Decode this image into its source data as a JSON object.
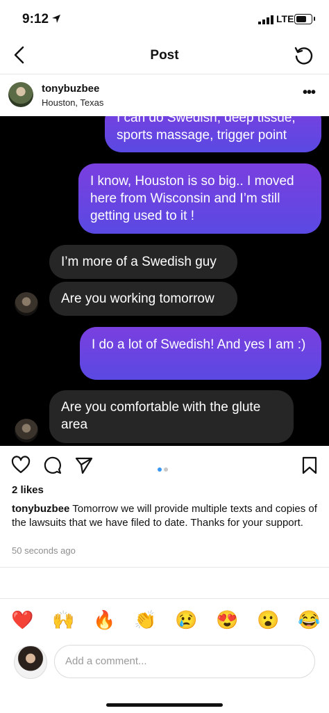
{
  "status": {
    "time": "9:12",
    "network": "LTE"
  },
  "nav": {
    "title": "Post"
  },
  "post": {
    "username": "tonybuzbee",
    "location": "Houston, Texas",
    "more": "•••"
  },
  "chat": {
    "messages": [
      {
        "side": "out",
        "text": "I can do Swedish, deep tissue, sports massage, trigger point"
      },
      {
        "side": "out",
        "text": "I know, Houston is so big.. I moved here from Wisconsin and I’m still getting used to it !"
      },
      {
        "side": "in",
        "text": "I’m more of a Swedish guy"
      },
      {
        "side": "in",
        "text": "Are you working tomorrow"
      },
      {
        "side": "out",
        "text": "I do a lot of Swedish! And yes I am :)"
      },
      {
        "side": "in",
        "text": "Are you comfortable with the glute area"
      }
    ]
  },
  "engagement": {
    "likes": "2 likes",
    "caption_user": "tonybuzbee",
    "caption_text": "Tomorrow we will provide multiple texts and copies of the lawsuits that we have filed to date. Thanks for your support.",
    "timestamp": "50 seconds ago",
    "carousel": {
      "count": 2,
      "active": 0
    }
  },
  "quick_reactions": [
    "❤️",
    "🙌",
    "🔥",
    "👏",
    "😢",
    "😍",
    "😮",
    "😂"
  ],
  "comment": {
    "placeholder": "Add a comment..."
  },
  "colors": {
    "accent_out": "#6a45e1",
    "bubble_in": "#262626",
    "dot_active": "#3897f0",
    "dot_inactive": "#c7c7c7"
  }
}
